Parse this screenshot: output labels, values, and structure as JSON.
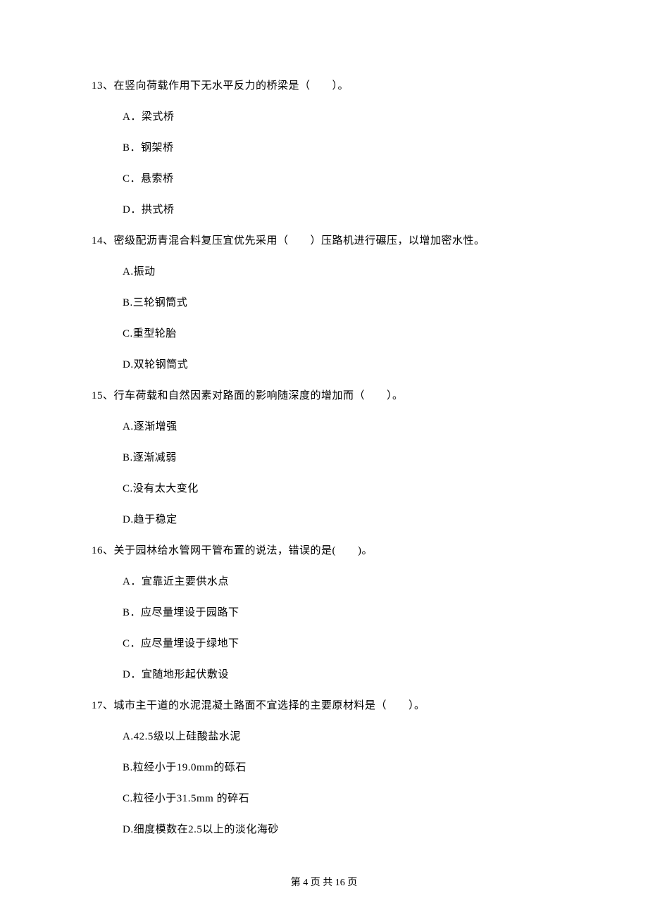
{
  "questions": [
    {
      "number": "13、",
      "stem_pre": "在竖向荷载作用下无水平反力的桥梁是（",
      "stem_blank": "　　",
      "stem_post": "）。",
      "options": [
        "A．梁式桥",
        "B．钢架桥",
        "C．悬索桥",
        "D．拱式桥"
      ]
    },
    {
      "number": "14、",
      "stem_pre": "密级配沥青混合料复压宜优先采用（",
      "stem_blank": "　　",
      "stem_post": "）压路机进行碾压，以增加密水性。",
      "options": [
        "A.振动",
        "B.三轮钢筒式",
        "C.重型轮胎",
        "D.双轮钢筒式"
      ]
    },
    {
      "number": "15、",
      "stem_pre": "行车荷载和自然因素对路面的影响随深度的增加而（",
      "stem_blank": "　　",
      "stem_post": "）。",
      "options": [
        "A.逐渐增强",
        "B.逐渐减弱",
        "C.没有太大变化",
        "D.趋于稳定"
      ]
    },
    {
      "number": "16、",
      "stem_pre": "关于园林给水管网干管布置的说法，错误的是(",
      "stem_blank": "　　",
      "stem_post": ")。",
      "options": [
        "A．宜靠近主要供水点",
        "B．应尽量埋设于园路下",
        "C．应尽量埋设于绿地下",
        "D．宜随地形起伏敷设"
      ]
    },
    {
      "number": "17、",
      "stem_pre": "城市主干道的水泥混凝土路面不宜选择的主要原材料是（",
      "stem_blank": "　　",
      "stem_post": "）。",
      "options": [
        "A.42.5级以上硅酸盐水泥",
        "B.粒经小于19.0mm的砾石",
        "C.粒径小于31.5mm 的碎石",
        "D.细度模数在2.5以上的淡化海砂"
      ]
    }
  ],
  "footer": "第 4 页 共 16 页"
}
